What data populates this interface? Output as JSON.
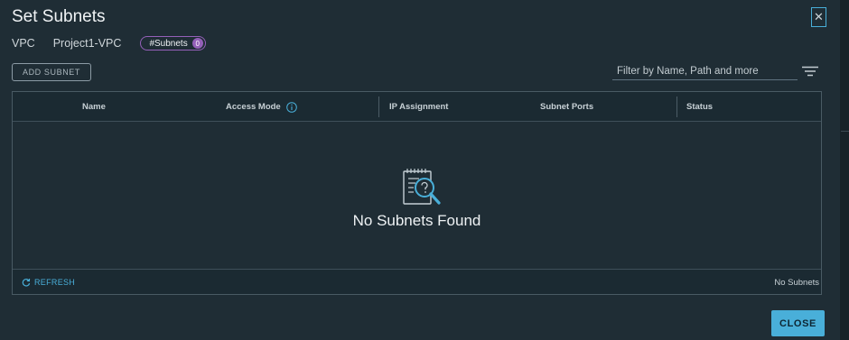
{
  "dialog": {
    "title": "Set Subnets",
    "close_icon": "close-icon"
  },
  "meta": {
    "vpc_label": "VPC",
    "vpc_name": "Project1-VPC",
    "badge_label": "#Subnets",
    "badge_count": "0"
  },
  "toolbar": {
    "add_subnet_label": "ADD SUBNET",
    "filter_placeholder": "Filter by Name, Path and more",
    "filter_icon": "filter-icon"
  },
  "grid": {
    "columns": [
      "Name",
      "Access Mode",
      "IP Assignment",
      "Subnet Ports",
      "Status"
    ],
    "info_icon": "info-icon",
    "empty_icon": "notepad-search-icon",
    "empty_message": "No Subnets Found",
    "refresh_label": "REFRESH",
    "refresh_icon": "refresh-icon",
    "footer_count": "No Subnets"
  },
  "footer": {
    "close_label": "CLOSE"
  },
  "colors": {
    "background": "#1f2d35",
    "accent": "#49afd9",
    "badge": "#9460b8"
  }
}
